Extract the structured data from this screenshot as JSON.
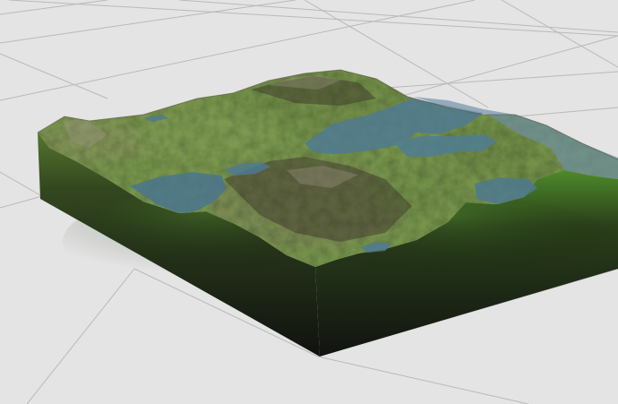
{
  "viewport": {
    "background_color": "#e4e4e4",
    "grid_line_color": "#b8b8b8"
  },
  "terrain": {
    "kind": "3D heightmap block",
    "colors": {
      "grass": "#6f8f44",
      "grass_dark": "#4d6b30",
      "rock": "#7a6e60",
      "rock_dark": "#4a4038",
      "water": "#4e7a95",
      "water_shallow": "#6d8fa8",
      "side_top": "#3f6a25",
      "side_bottom": "#0e0f0e"
    }
  }
}
